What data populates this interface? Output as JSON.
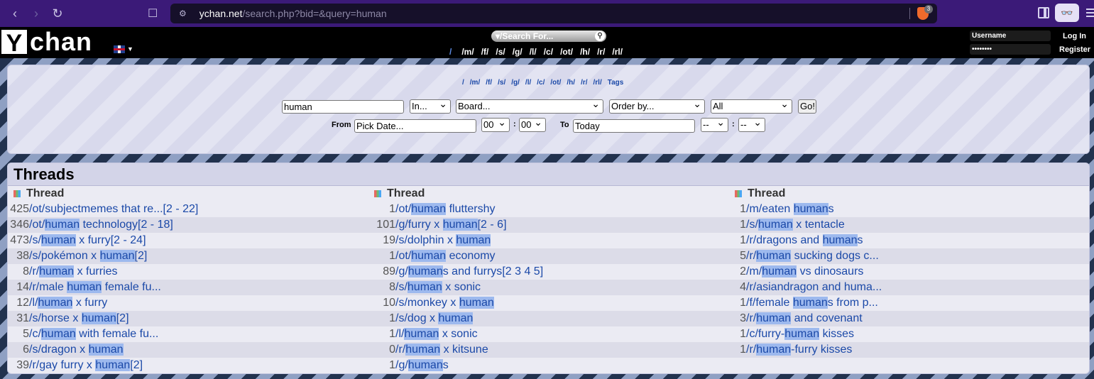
{
  "browser": {
    "url_host": "ychan.net",
    "url_path": "/search.php?bid=&query=human",
    "shield_count": "3"
  },
  "header": {
    "logo_letter": "Y",
    "logo_rest": "chan",
    "search_label": "/Search For...",
    "boards": [
      "/",
      "/m/",
      "/f/",
      "/s/",
      "/g/",
      "/l/",
      "/c/",
      "/ot/",
      "/h/",
      "/r/",
      "/rl/"
    ],
    "username_placeholder": "Username",
    "password_mask": "••••••••",
    "login_label": "Log In",
    "register_label": "Register"
  },
  "search_panel": {
    "boards": [
      "/",
      "/m/",
      "/f/",
      "/s/",
      "/g/",
      "/l/",
      "/c/",
      "/ot/",
      "/h/",
      "/r/",
      "/rl/",
      "Tags"
    ],
    "query": "human",
    "in_select": "In...",
    "board_select": "Board...",
    "order_select": "Order by...",
    "scope_select": "All",
    "go_label": "Go!",
    "from_label": "From",
    "from_date": "Pick Date...",
    "from_hour": "00",
    "from_min": "00",
    "to_label": "To",
    "to_date": "Today",
    "to_hour": "--",
    "to_min": "--",
    "colon": ":"
  },
  "threads": {
    "title": "Threads",
    "column_header": "Thread",
    "columns": [
      [
        {
          "count": "425",
          "pre": "/ot/subjectmemes that re...",
          "hl": "",
          "post": "",
          "pages": " [2 - 22]"
        },
        {
          "count": "346",
          "pre": "/ot/",
          "hl": "human",
          "post": " technology",
          "pages": " [2 - 18]"
        },
        {
          "count": "473",
          "pre": "/s/",
          "hl": "human",
          "post": " x furry",
          "pages": " [2 - 24]"
        },
        {
          "count": "38",
          "pre": "/s/pokémon x ",
          "hl": "human",
          "post": "",
          "pages": " [2]"
        },
        {
          "count": "8",
          "pre": "/r/",
          "hl": "human",
          "post": " x furries",
          "pages": ""
        },
        {
          "count": "14",
          "pre": "/r/male ",
          "hl": "human",
          "post": " female fu...",
          "pages": ""
        },
        {
          "count": "12",
          "pre": "/l/",
          "hl": "human",
          "post": " x furry",
          "pages": ""
        },
        {
          "count": "31",
          "pre": "/s/horse x ",
          "hl": "human",
          "post": "",
          "pages": " [2]"
        },
        {
          "count": "5",
          "pre": "/c/",
          "hl": "human",
          "post": " with female fu...",
          "pages": ""
        },
        {
          "count": "6",
          "pre": "/s/dragon x ",
          "hl": "human",
          "post": "",
          "pages": ""
        },
        {
          "count": "39",
          "pre": "/r/gay furry x ",
          "hl": "human",
          "post": "",
          "pages": " [2]"
        }
      ],
      [
        {
          "count": "1",
          "pre": "/ot/",
          "hl": "human",
          "post": " fluttershy",
          "pages": ""
        },
        {
          "count": "101",
          "pre": "/g/furry x ",
          "hl": "human",
          "post": "",
          "pages": " [2 - 6]"
        },
        {
          "count": "19",
          "pre": "/s/dolphin x ",
          "hl": "human",
          "post": "",
          "pages": ""
        },
        {
          "count": "1",
          "pre": "/ot/",
          "hl": "human",
          "post": " economy",
          "pages": ""
        },
        {
          "count": "89",
          "pre": "/g/",
          "hl": "human",
          "post": "s and furrys",
          "pages": " [2 3 4 5]"
        },
        {
          "count": "8",
          "pre": "/s/",
          "hl": "human",
          "post": " x sonic",
          "pages": ""
        },
        {
          "count": "10",
          "pre": "/s/monkey x ",
          "hl": "human",
          "post": "",
          "pages": ""
        },
        {
          "count": "1",
          "pre": "/s/dog x ",
          "hl": "human",
          "post": "",
          "pages": ""
        },
        {
          "count": "1",
          "pre": "/l/",
          "hl": "human",
          "post": " x sonic",
          "pages": ""
        },
        {
          "count": "0",
          "pre": "/r/",
          "hl": "human",
          "post": " x kitsune",
          "pages": ""
        },
        {
          "count": "1",
          "pre": "/g/",
          "hl": "human",
          "post": "s",
          "pages": ""
        }
      ],
      [
        {
          "count": "1",
          "pre": "/m/eaten ",
          "hl": "human",
          "post": "s",
          "pages": ""
        },
        {
          "count": "1",
          "pre": "/s/",
          "hl": "human",
          "post": " x tentacle",
          "pages": ""
        },
        {
          "count": "1",
          "pre": "/r/dragons and ",
          "hl": "human",
          "post": "s",
          "pages": ""
        },
        {
          "count": "5",
          "pre": "/r/",
          "hl": "human",
          "post": " sucking dogs c...",
          "pages": ""
        },
        {
          "count": "2",
          "pre": "/m/",
          "hl": "human",
          "post": " vs dinosaurs",
          "pages": ""
        },
        {
          "count": "4",
          "pre": "/r/asiandragon and huma...",
          "hl": "",
          "post": "",
          "pages": ""
        },
        {
          "count": "1",
          "pre": "/f/female ",
          "hl": "human",
          "post": "s from p...",
          "pages": ""
        },
        {
          "count": "3",
          "pre": "/r/",
          "hl": "human",
          "post": " and covenant",
          "pages": ""
        },
        {
          "count": "1",
          "pre": "/c/furry-",
          "hl": "human",
          "post": " kisses",
          "pages": ""
        },
        {
          "count": "1",
          "pre": "/r/",
          "hl": "human",
          "post": "-furry kisses",
          "pages": ""
        }
      ]
    ]
  }
}
